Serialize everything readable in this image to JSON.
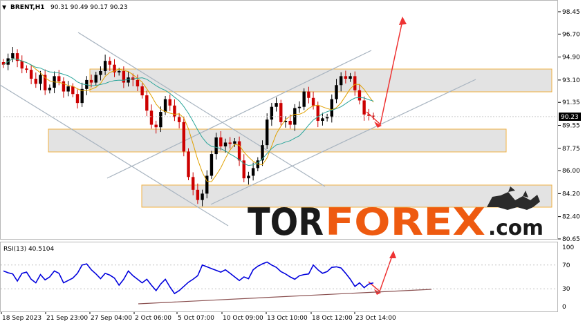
{
  "header": {
    "symbol": "BRENT,H1",
    "ohlc": "90.31 90.49 90.17 90.23"
  },
  "logo": {
    "part1": "TOR",
    "part2": "FOREX",
    "part3": ".com"
  },
  "rsi": {
    "label": "RSI(13) 40.5104"
  },
  "colors": {
    "bg": "#ffffff",
    "candle_up": "#000000",
    "candle_down": "#cc0000",
    "ma_fast": "#e0a000",
    "ma_slow": "#2aa59a",
    "rsi_line": "#0000dd",
    "zone_fill": "#e3e3e3",
    "zone_stroke": "#f0b040",
    "channel": "#a8b4c0",
    "arrow": "#ee3333",
    "logo_dark": "#1a1a1a",
    "logo_orange": "#ee5a10"
  },
  "chart_data": [
    {
      "type": "line",
      "title": "BRENT,H1",
      "ylim": [
        80.65,
        98.45
      ],
      "y_ticks": [
        "98.45",
        "96.70",
        "94.90",
        "93.10",
        "91.35",
        "89.55",
        "87.75",
        "86.00",
        "84.20",
        "82.40",
        "80.65"
      ],
      "current_price": "90.23",
      "x_ticks": [
        "18 Sep 2023",
        "21 Sep 23:00",
        "27 Sep 04:00",
        "2 Oct 06:00",
        "5 Oct 07:00",
        "10 Oct 09:00",
        "13 Oct 10:00",
        "18 Oct 12:00",
        "23 Oct 14:00"
      ],
      "series": [
        {
          "values": [
            94.3,
            94.8,
            95.2,
            94.6,
            94.0,
            93.9,
            93.2,
            92.8,
            93.5,
            92.3,
            92.5,
            93.4,
            93.0,
            92.2,
            92.6,
            92.0,
            91.3,
            92.4,
            93.1,
            92.9,
            93.5,
            93.8,
            94.6,
            94.3,
            93.7,
            93.8,
            92.9,
            93.3,
            93.1,
            92.6,
            91.9,
            90.7,
            89.6,
            89.4,
            90.6,
            91.6,
            91.1,
            90.2,
            89.8,
            87.5,
            85.5,
            84.5,
            83.7,
            84.2,
            85.6,
            87.3,
            88.6,
            87.9,
            88.2,
            88.1,
            88.3,
            86.8,
            85.4,
            85.6,
            86.2,
            86.8,
            88.0,
            90.0,
            91.0,
            91.3,
            89.8,
            89.9,
            89.6,
            90.9,
            91.0,
            92.2,
            91.7,
            91.1,
            89.9,
            90.1,
            90.2,
            91.6,
            92.7,
            93.4,
            93.2,
            93.4,
            92.3,
            91.5,
            90.4,
            90.3,
            90.23
          ]
        }
      ],
      "resistance_zones": [
        [
          93.98,
          92.22
        ],
        [
          89.38,
          87.65
        ],
        [
          84.9,
          83.18
        ]
      ]
    },
    {
      "type": "line",
      "title": "RSI(13) 40.5104",
      "ylim": [
        0,
        100
      ],
      "y_ticks": [
        "100",
        "70",
        "30",
        "0"
      ],
      "series": [
        {
          "values": [
            60,
            57,
            55,
            43,
            56,
            58,
            46,
            40,
            54,
            45,
            50,
            60,
            56,
            40,
            44,
            48,
            56,
            70,
            72,
            62,
            55,
            47,
            56,
            53,
            48,
            36,
            46,
            60,
            52,
            46,
            40,
            46,
            36,
            27,
            38,
            46,
            33,
            22,
            27,
            34,
            41,
            46,
            52,
            70,
            67,
            64,
            61,
            58,
            62,
            56,
            50,
            44,
            50,
            47,
            62,
            68,
            72,
            75,
            70,
            66,
            59,
            55,
            50,
            46,
            52,
            54,
            55,
            70,
            62,
            56,
            59,
            66,
            67,
            65,
            56,
            46,
            34,
            40,
            32,
            38,
            40
          ]
        }
      ]
    }
  ]
}
